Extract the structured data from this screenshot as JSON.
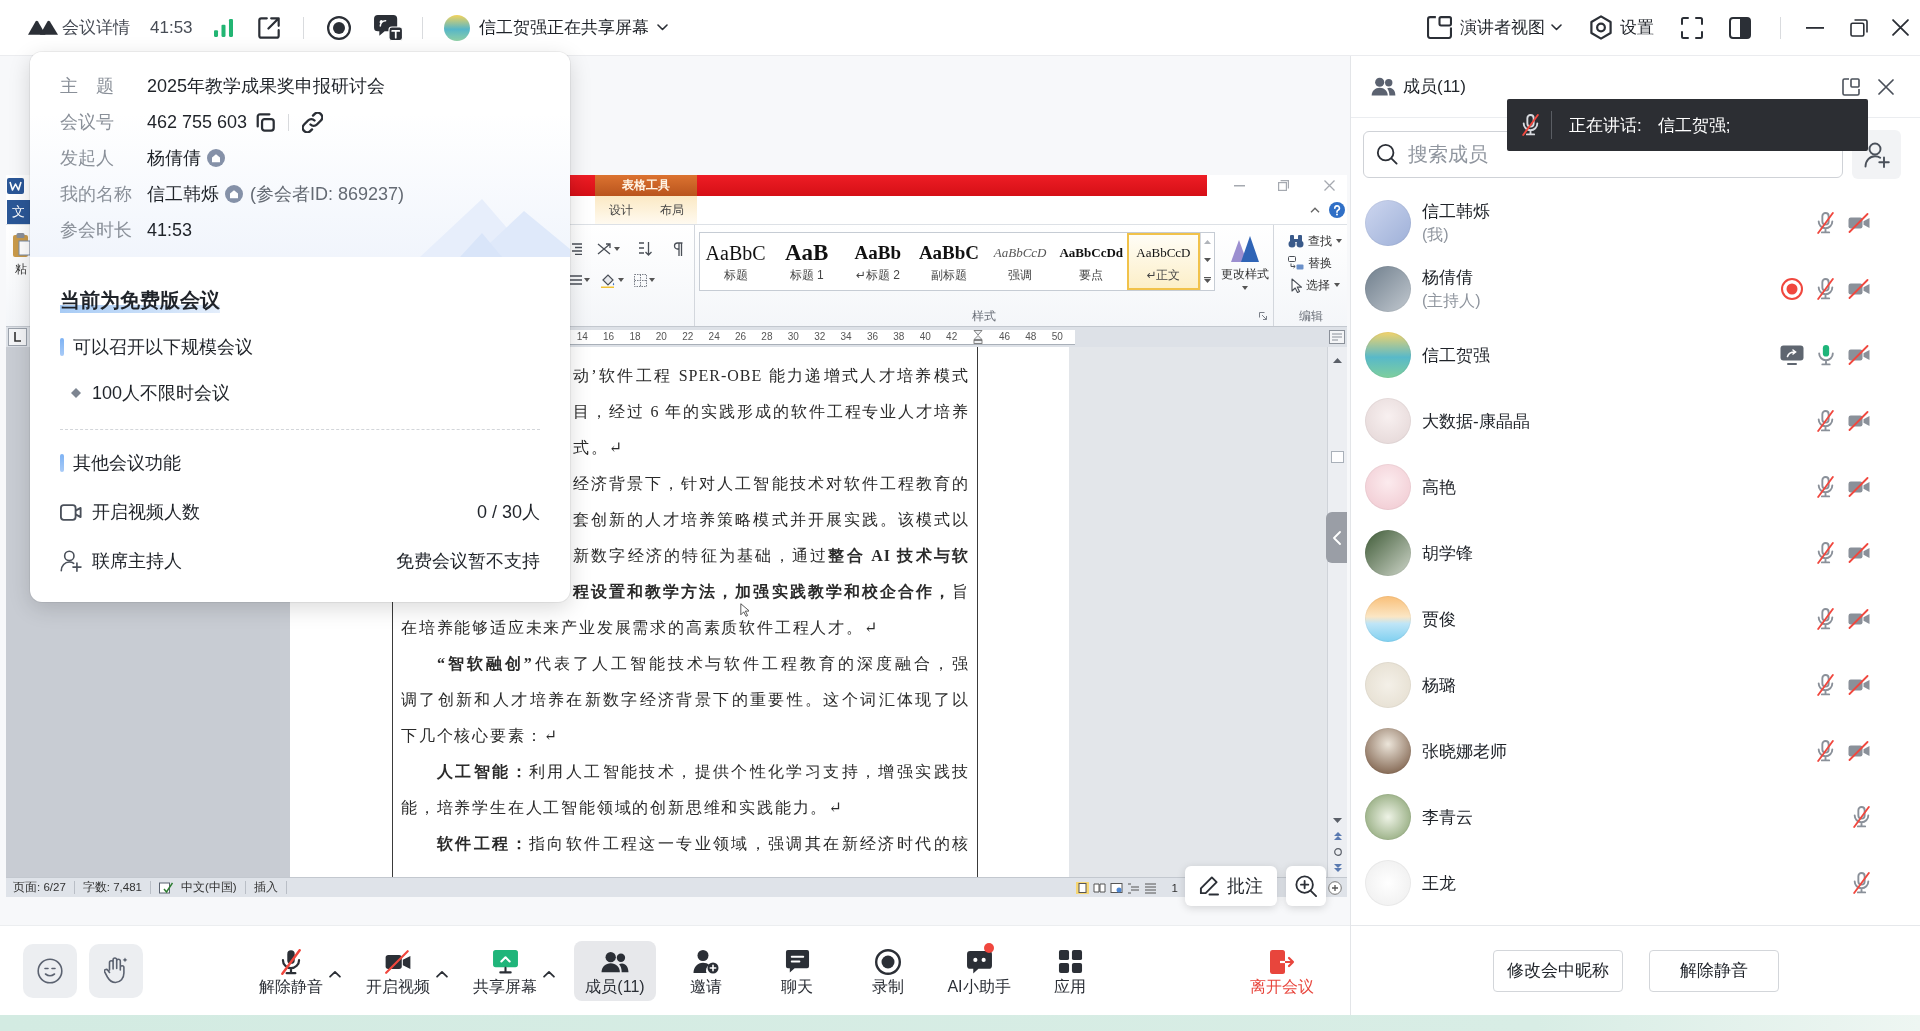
{
  "top_bar": {
    "meeting_info": "会议详情",
    "timer": "41:53",
    "sharing_status": "信工贺强正在共享屏幕",
    "view_mode": "演讲者视图",
    "settings": "设置"
  },
  "meeting_info_card": {
    "fields": [
      {
        "kind": "text",
        "label": "主　题",
        "value": "2025年教学成果奖申报研讨会"
      },
      {
        "kind": "meeting_number",
        "label": "会议号",
        "value": "462 755 603"
      },
      {
        "kind": "person",
        "label": "发起人",
        "value": "杨倩倩"
      },
      {
        "kind": "person",
        "label": "我的名称",
        "value": "信工韩烁",
        "note": "(参会者ID: 869237)"
      },
      {
        "kind": "text",
        "label": "参会时长",
        "value": "41:53"
      }
    ],
    "plan_title": "当前为免费版会议",
    "capacity_heading": "可以召开以下规模会议",
    "capacity_items": [
      "100人不限时会议"
    ],
    "features_heading": "其他会议功能",
    "features": [
      {
        "kind": "video",
        "label": "开启视频人数",
        "value": "0 / 30人"
      },
      {
        "kind": "cohost",
        "label": "联席主持人",
        "value": "免费会议暂不支持"
      }
    ]
  },
  "shared_screen": {
    "word": {
      "file_tab": "文",
      "contextual_group": "表格工具",
      "contextual_tabs": [
        {
          "label": "设计",
          "selected": false
        },
        {
          "label": "布局",
          "selected": false
        }
      ],
      "paste_label": "粘",
      "styles": [
        {
          "kind": "title",
          "sample": "AaBbC",
          "label": "标题",
          "selected": false
        },
        {
          "kind": "heading1",
          "sample": "AaB",
          "label": "标题 1",
          "selected": false
        },
        {
          "kind": "heading2",
          "sample": "AaBb",
          "label": "↵标题 2",
          "selected": false
        },
        {
          "kind": "subtitle",
          "sample": "AaBbC",
          "label": "副标题",
          "selected": false
        },
        {
          "kind": "emphasis",
          "sample": "AaBbCcD",
          "label": "强调",
          "selected": false
        },
        {
          "kind": "strong",
          "sample": "AaBbCcDd",
          "label": "要点",
          "selected": false
        },
        {
          "kind": "normal",
          "sample": "AaBbCcD",
          "label": "↵正文",
          "selected": true
        }
      ],
      "change_styles": "更改样式",
      "styles_group": "样式",
      "editing": [
        {
          "kind": "find",
          "label": "查找",
          "menu": true
        },
        {
          "kind": "replace",
          "label": "替换",
          "menu": false
        },
        {
          "kind": "select",
          "label": "选择",
          "menu": true
        }
      ],
      "editing_group": "编辑",
      "ruler": [
        {
          "kind": "number",
          "label": "14"
        },
        {
          "kind": "number",
          "label": "16"
        },
        {
          "kind": "number",
          "label": "18"
        },
        {
          "kind": "number",
          "label": "20"
        },
        {
          "kind": "number",
          "label": "22"
        },
        {
          "kind": "number",
          "label": "24"
        },
        {
          "kind": "number",
          "label": "26"
        },
        {
          "kind": "number",
          "label": "28"
        },
        {
          "kind": "number",
          "label": "30"
        },
        {
          "kind": "number",
          "label": "32"
        },
        {
          "kind": "number",
          "label": "34"
        },
        {
          "kind": "number",
          "label": "36"
        },
        {
          "kind": "number",
          "label": "38"
        },
        {
          "kind": "number",
          "label": "40"
        },
        {
          "kind": "number",
          "label": "42"
        },
        {
          "kind": "indent_marker"
        },
        {
          "kind": "number",
          "label": "46"
        },
        {
          "kind": "number",
          "label": "48"
        },
        {
          "kind": "number",
          "label": "50"
        }
      ],
      "lines": [
        {
          "kind": "covered",
          "text": "动’软件工程 SPER-OBE 能力递增式人才培养模式"
        },
        {
          "kind": "covered",
          "text": "目，经过 6 年的实践形成的软件工程专业人才培养"
        },
        {
          "kind": "covered_end",
          "text": "式。↵"
        },
        {
          "kind": "covered",
          "text": "经济背景下，针对人工智能技术对软件工程教育的"
        },
        {
          "kind": "covered",
          "text": "套创新的人才培养策略模式并开展实践。该模式以"
        },
        {
          "kind": "covered",
          "text": "新数字经济的特征为基础，通过**整合 AI 技术与软**"
        },
        {
          "kind": "covered",
          "text": "**程设置和教学方法，加强实践教学和校企合作，**旨"
        },
        {
          "kind": "end",
          "text": "在培养能够适应未来产业发展需求的高素质软件工程人才。↵"
        },
        {
          "kind": "indented",
          "text": "**“智软融创”**代表了人工智能技术与软件工程教育的深度融合，强"
        },
        {
          "kind": "line",
          "text": "调了创新和人才培养在新数字经济背景下的重要性。这个词汇体现了以"
        },
        {
          "kind": "end",
          "text": "下几个核心要素：↵"
        },
        {
          "kind": "indented",
          "text": "**人工智能：**利用人工智能技术，提供个性化学习支持，增强实践技"
        },
        {
          "kind": "end",
          "text": "能，培养学生在人工智能领域的创新思维和实践能力。↵"
        },
        {
          "kind": "indented",
          "text": "**软件工程：**指向软件工程这一专业领域，强调其在新经济时代的核"
        }
      ],
      "status_bar": {
        "page": "页面: 6/27",
        "words": "字数: 7,481",
        "language": "中文(中国)",
        "mode": "插入",
        "zoom": "1"
      }
    },
    "annotate_button": "批注"
  },
  "members_panel": {
    "title": "成员(11)",
    "search_placeholder": "搜索成员",
    "speaking_toast": {
      "label": "正在讲话:",
      "speakers": "信工贺强;"
    },
    "members": [
      {
        "name": "信工韩烁",
        "role": "(我)",
        "recording": false,
        "sharing": false,
        "mic_muted": true,
        "camera_off": true
      },
      {
        "name": "杨倩倩",
        "role": "(主持人)",
        "recording": true,
        "sharing": false,
        "mic_muted": true,
        "camera_off": true
      },
      {
        "name": "信工贺强",
        "recording": false,
        "sharing": true,
        "mic_muted": false,
        "camera_off": true
      },
      {
        "name": "大数据-康晶晶",
        "recording": false,
        "sharing": false,
        "mic_muted": true,
        "camera_off": true
      },
      {
        "name": "高艳",
        "recording": false,
        "sharing": false,
        "mic_muted": true,
        "camera_off": true
      },
      {
        "name": "胡学锋",
        "recording": false,
        "sharing": false,
        "mic_muted": true,
        "camera_off": true
      },
      {
        "name": "贾俊",
        "recording": false,
        "sharing": false,
        "mic_muted": true,
        "camera_off": true
      },
      {
        "name": "杨璐",
        "recording": false,
        "sharing": false,
        "mic_muted": true,
        "camera_off": true
      },
      {
        "name": "张晓娜老师",
        "recording": false,
        "sharing": false,
        "mic_muted": true,
        "camera_off": true
      },
      {
        "name": "李青云",
        "recording": false,
        "sharing": false,
        "mic_muted": true
      },
      {
        "name": "王龙",
        "recording": false,
        "sharing": false,
        "mic_muted": true
      }
    ],
    "buttons": [
      "修改会中昵称",
      "解除静音"
    ]
  },
  "toolbar": {
    "items": [
      {
        "kind": "mic_off",
        "label": "解除静音",
        "menu": true,
        "selected": false,
        "notification": false
      },
      {
        "kind": "camera_off",
        "label": "开启视频",
        "menu": true,
        "selected": false,
        "notification": false
      },
      {
        "kind": "share",
        "label": "共享屏幕",
        "menu": true,
        "selected": false,
        "notification": false
      },
      {
        "kind": "members",
        "label": "成员(11)",
        "menu": false,
        "selected": true,
        "notification": false
      },
      {
        "kind": "invite",
        "label": "邀请",
        "menu": false,
        "selected": false,
        "notification": false
      },
      {
        "kind": "chat",
        "label": "聊天",
        "menu": false,
        "selected": false,
        "notification": false
      },
      {
        "kind": "record",
        "label": "录制",
        "menu": false,
        "selected": false,
        "notification": false
      },
      {
        "kind": "assistant",
        "label": "AI小助手",
        "menu": false,
        "selected": false,
        "notification": true
      },
      {
        "kind": "apps",
        "label": "应用",
        "menu": false,
        "selected": false,
        "notification": false
      }
    ],
    "leave": "离开会议"
  }
}
